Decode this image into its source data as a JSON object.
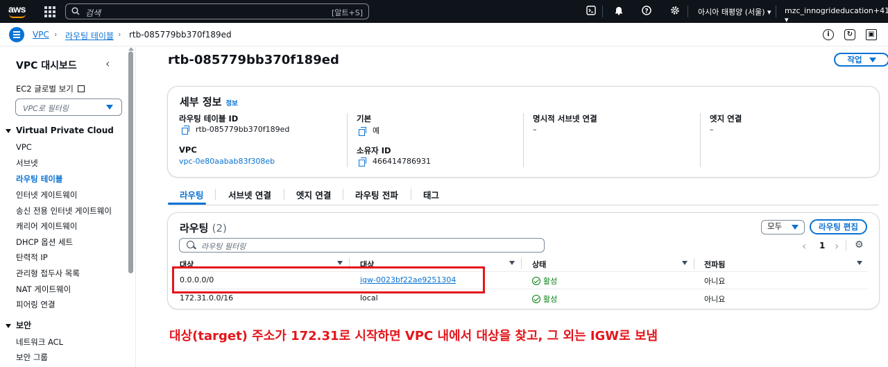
{
  "topbar": {
    "search_placeholder": "검색",
    "search_shortcut": "[알트+S]",
    "region": "아시아 태평양 (서울) ▾",
    "account": "mzc_innogrideducation+41 ▾"
  },
  "breadcrumb": {
    "items": [
      "VPC",
      "라우팅 테이블",
      "rtb-085779bb370f189ed"
    ]
  },
  "sidebar": {
    "title": "VPC 대시보드",
    "global_view": "EC2 글로벌 보기",
    "filter_placeholder": "VPC로 필터링",
    "section_vpc": "Virtual Private Cloud",
    "items": [
      "VPC",
      "서브넷",
      "라우팅 테이블",
      "인터넷 게이트웨이",
      "송신 전용 인터넷 게이트웨이",
      "캐리어 게이트웨이",
      "DHCP 옵션 세트",
      "탄력적 IP",
      "관리형 접두사 목록",
      "NAT 게이트웨이",
      "피어링 연결"
    ],
    "section_security": "보안",
    "security_items": [
      "네트워크 ACL",
      "보안 그룹"
    ]
  },
  "page": {
    "title": "rtb-085779bb370f189ed",
    "actions_label": "작업"
  },
  "details": {
    "title": "세부 정보",
    "info": "정보",
    "rt_id_label": "라우팅 테이블 ID",
    "rt_id_value": "rtb-085779bb370f189ed",
    "main_label": "기본",
    "main_value": "예",
    "explicit_subnet_label": "명시적 서브넷 연결",
    "explicit_subnet_value": "–",
    "edge_label": "엣지 연결",
    "edge_value": "–",
    "vpc_label": "VPC",
    "vpc_value": "vpc-0e80aabab83f308eb",
    "owner_label": "소유자 ID",
    "owner_value": "466414786931"
  },
  "tabs": [
    "라우팅",
    "서브넷 연결",
    "엣지 연결",
    "라우팅 전파",
    "태그"
  ],
  "routes": {
    "title": "라우팅",
    "count": "(2)",
    "filter_all": "모두",
    "edit_label": "라우팅 편집",
    "filter_placeholder": "라우팅 필터링",
    "page_number": "1",
    "columns": [
      "대상",
      "대상",
      "상태",
      "전파됨"
    ],
    "rows": [
      {
        "destination": "0.0.0.0/0",
        "target": "igw-0023bf22ae9251304",
        "status": "활성",
        "propagated": "아니요"
      },
      {
        "destination": "172.31.0.0/16",
        "target": "local",
        "status": "활성",
        "propagated": "아니요"
      }
    ]
  },
  "annotation": "대상(target) 주소가 172.31로 시작하면 VPC 내에서 대상을 찾고, 그 외는 IGW로 보냄"
}
